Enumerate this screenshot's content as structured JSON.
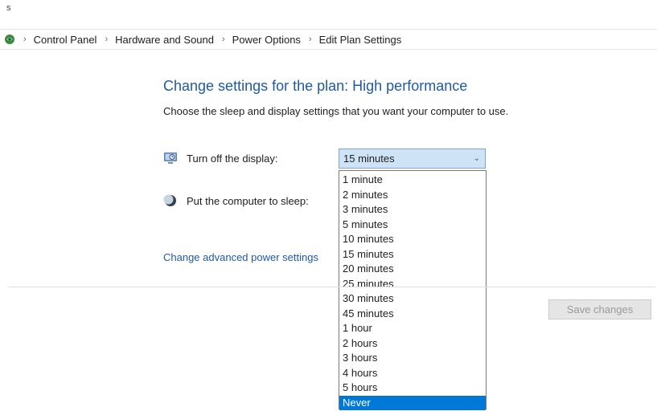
{
  "corner_text": "s",
  "breadcrumb": {
    "icon": "control-panel-icon",
    "items": [
      "Control Panel",
      "Hardware and Sound",
      "Power Options",
      "Edit Plan Settings"
    ]
  },
  "page": {
    "title": "Change settings for the plan: High performance",
    "description": "Choose the sleep and display settings that you want your computer to use."
  },
  "settings": {
    "display": {
      "icon": "monitor-icon",
      "label": "Turn off the display:",
      "selected": "15 minutes"
    },
    "sleep": {
      "icon": "moon-icon",
      "label": "Put the computer to sleep:"
    }
  },
  "dropdown": {
    "options": [
      "1 minute",
      "2 minutes",
      "3 minutes",
      "5 minutes",
      "10 minutes",
      "15 minutes",
      "20 minutes",
      "25 minutes",
      "30 minutes",
      "45 minutes",
      "1 hour",
      "2 hours",
      "3 hours",
      "4 hours",
      "5 hours",
      "Never"
    ],
    "highlighted": "Never"
  },
  "links": {
    "advanced": "Change advanced power settings"
  },
  "buttons": {
    "save": "Save changes"
  },
  "colors": {
    "link": "#1e5aa8",
    "highlight": "#0078d7",
    "combo_bg": "#cfe3f7"
  }
}
